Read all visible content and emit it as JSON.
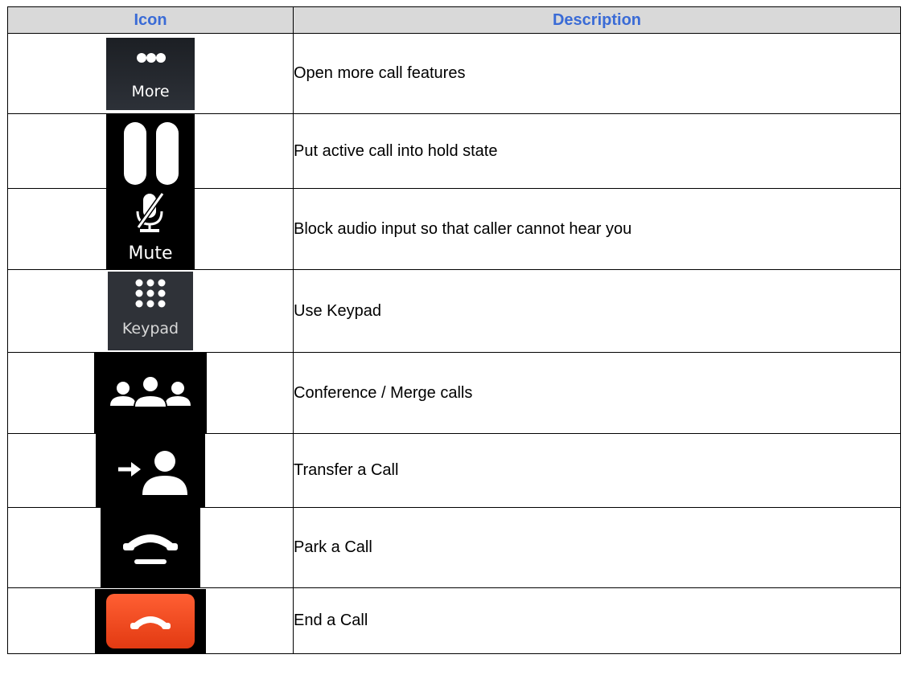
{
  "table": {
    "headers": {
      "icon": "Icon",
      "description": "Description"
    },
    "rows": [
      {
        "icon": "more-icon",
        "label": "More",
        "description": "Open more call features"
      },
      {
        "icon": "hold-icon",
        "label": "",
        "description": "Put active call into hold state"
      },
      {
        "icon": "mute-icon",
        "label": "Mute",
        "description": "Block audio input so that caller cannot hear you"
      },
      {
        "icon": "keypad-icon",
        "label": "Keypad",
        "description": "Use Keypad"
      },
      {
        "icon": "conference-icon",
        "label": "",
        "description": "Conference / Merge calls"
      },
      {
        "icon": "transfer-icon",
        "label": "",
        "description": "Transfer a Call"
      },
      {
        "icon": "park-icon",
        "label": "",
        "description": "Park a Call"
      },
      {
        "icon": "end-call-icon",
        "label": "",
        "description": "End a Call"
      }
    ]
  },
  "colors": {
    "header_background": "#d9d9d9",
    "header_text": "#3a6bd6",
    "icon_dark_background": "#000000",
    "keypad_background": "#2f3238",
    "end_call_red": "#f0441c"
  }
}
